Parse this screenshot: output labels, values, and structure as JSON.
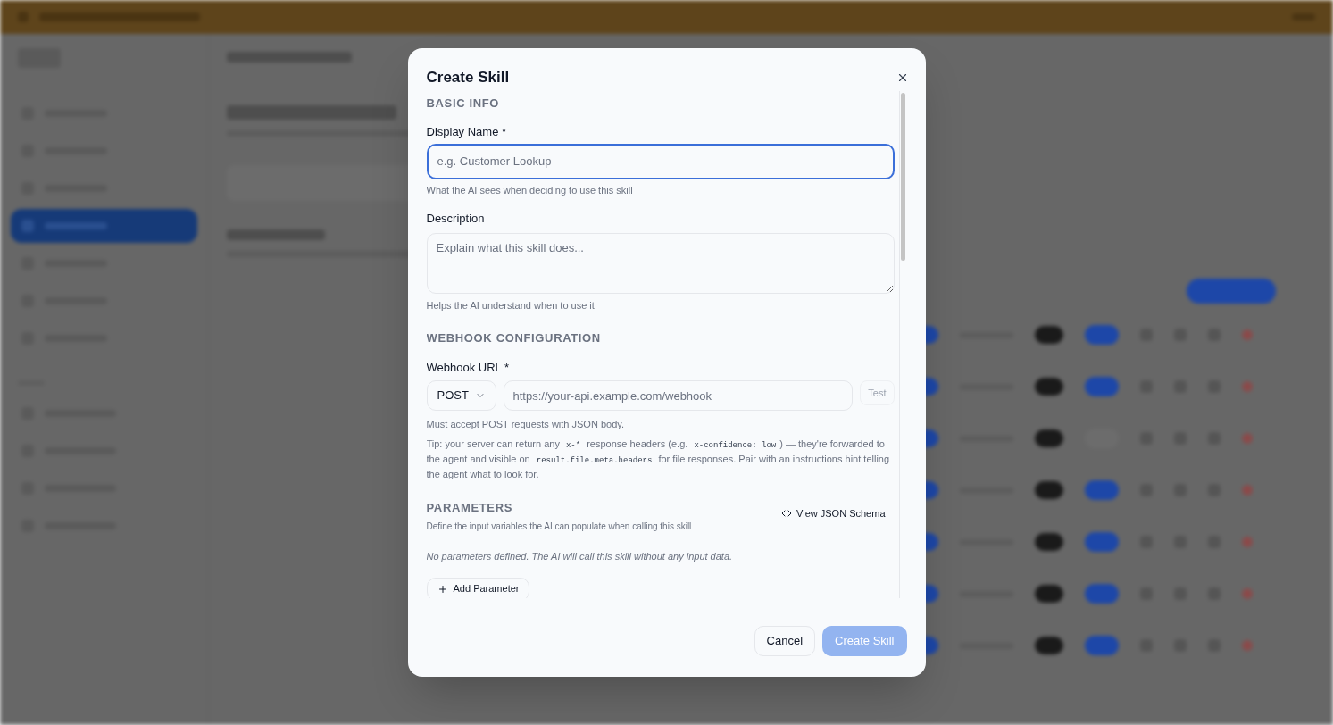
{
  "dialog": {
    "title": "Create Skill",
    "basic_info": {
      "heading": "BASIC INFO",
      "display_name": {
        "label": "Display Name *",
        "placeholder": "e.g. Customer Lookup",
        "hint": "What the AI sees when deciding to use this skill",
        "focused": true
      },
      "description": {
        "label": "Description",
        "placeholder": "Explain what this skill does...",
        "hint": "Helps the AI understand when to use it"
      }
    },
    "webhook": {
      "heading": "WEBHOOK CONFIGURATION",
      "label": "Webhook URL *",
      "method": "POST",
      "placeholder": "https://your-api.example.com/webhook",
      "test_button": "Test",
      "hint": "Must accept POST requests with JSON body.",
      "tip": [
        {
          "kind": "text",
          "text": "Tip: your server can return any "
        },
        {
          "kind": "code",
          "text": "x-*"
        },
        {
          "kind": "text",
          "text": " response headers (e.g. "
        },
        {
          "kind": "code",
          "text": "x-confidence: low"
        },
        {
          "kind": "text",
          "text": ") — they're forwarded to the agent and visible on "
        },
        {
          "kind": "code",
          "text": "result.file.meta.headers"
        },
        {
          "kind": "text",
          "text": " for file responses. Pair with an instructions hint telling the agent what to look for."
        }
      ]
    },
    "parameters": {
      "heading": "PARAMETERS",
      "description": "Define the input variables the AI can populate when calling this skill",
      "schema_button": "View JSON Schema",
      "empty_text": "No parameters defined. The AI will call this skill without any input data.",
      "add_button": "Add Parameter"
    },
    "footer": {
      "cancel": "Cancel",
      "create": {
        "label": "Create Skill",
        "disabled": true
      }
    }
  }
}
